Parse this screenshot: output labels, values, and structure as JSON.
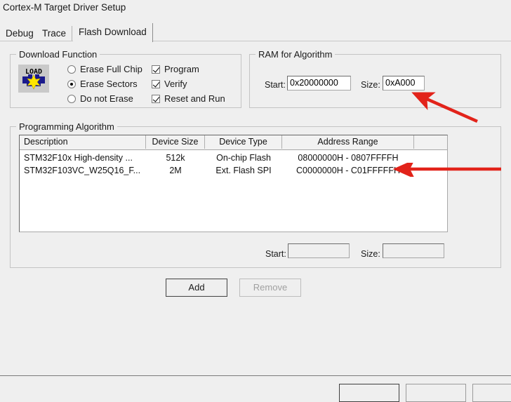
{
  "window": {
    "title": "Cortex-M Target Driver Setup"
  },
  "tabs": [
    {
      "label": "Debug",
      "active": false
    },
    {
      "label": "Trace",
      "active": false
    },
    {
      "label": "Flash Download",
      "active": true
    }
  ],
  "download_function": {
    "legend": "Download Function",
    "icon": "load-icon",
    "icon_text": "LOAD",
    "erase_mode": "Erase Sectors",
    "radios": [
      {
        "label": "Erase Full Chip",
        "checked": false
      },
      {
        "label": "Erase Sectors",
        "checked": true
      },
      {
        "label": "Do not Erase",
        "checked": false
      }
    ],
    "checks": [
      {
        "label": "Program",
        "checked": true
      },
      {
        "label": "Verify",
        "checked": true
      },
      {
        "label": "Reset and Run",
        "checked": true
      }
    ]
  },
  "ram_for_algorithm": {
    "legend": "RAM for Algorithm",
    "start_label": "Start:",
    "start_value": "0x20000000",
    "size_label": "Size:",
    "size_value": "0xA000"
  },
  "programming_algorithm": {
    "legend": "Programming Algorithm",
    "columns": [
      "Description",
      "Device Size",
      "Device Type",
      "Address Range",
      ""
    ],
    "rows": [
      {
        "description": "STM32F10x High-density ...",
        "device_size": "512k",
        "device_type": "On-chip Flash",
        "address_range": "08000000H - 0807FFFFH"
      },
      {
        "description": "STM32F103VC_W25Q16_F...",
        "device_size": "2M",
        "device_type": "Ext. Flash SPI",
        "address_range": "C0000000H - C01FFFFFH"
      }
    ],
    "start_label": "Start:",
    "start_value": "",
    "size_label": "Size:",
    "size_value": "",
    "add_label": "Add",
    "remove_label": "Remove",
    "remove_enabled": false
  },
  "annotations": {
    "arrow_color": "#e2231a",
    "arrows": [
      {
        "name": "arrow-to-ram-size",
        "points_at": "RAM for Algorithm Size field"
      },
      {
        "name": "arrow-to-address-range",
        "points_at": "C0000000H - C01FFFFFH row"
      }
    ]
  }
}
